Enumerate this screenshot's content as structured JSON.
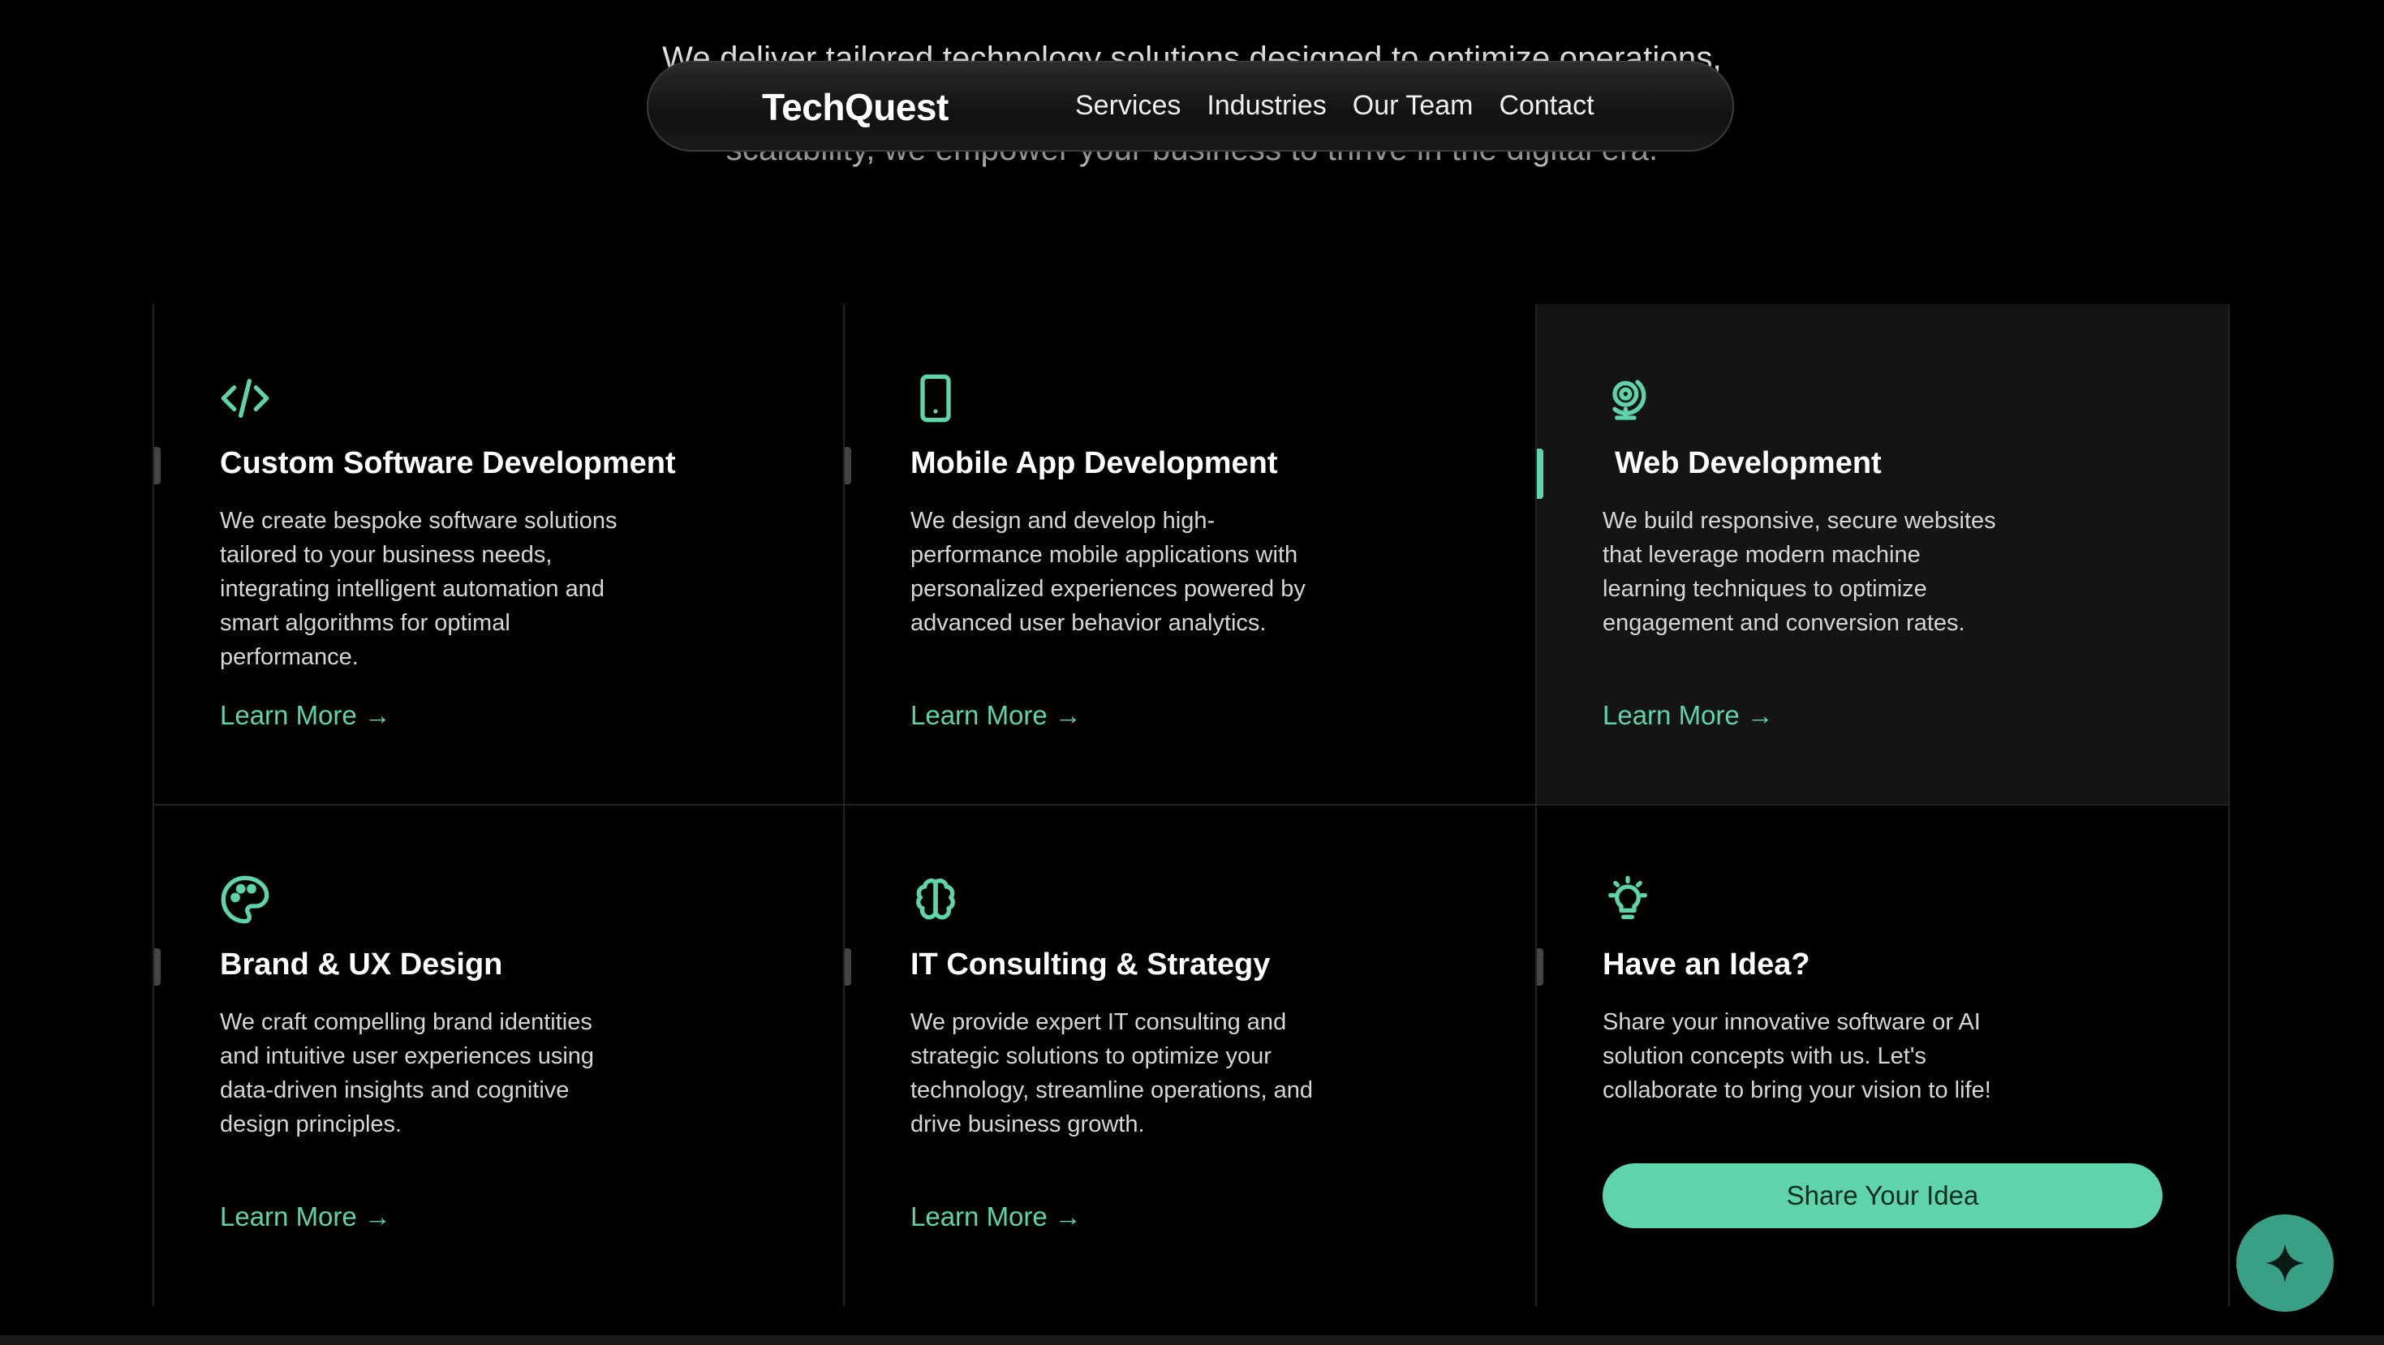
{
  "hero": {
    "line1": "We deliver tailored technology solutions designed to optimize operations,",
    "line2": "scalability, we empower your business to thrive in the digital era."
  },
  "navbar": {
    "logo": "TechQuest",
    "links": [
      "Services",
      "Industries",
      "Our Team",
      "Contact"
    ]
  },
  "colors": {
    "accent": "#5fd4aa",
    "background": "#000000",
    "highlight_card": "#141414",
    "fab": "#3aa085"
  },
  "services": [
    {
      "icon": "code-icon",
      "title": "Custom Software Development",
      "description": "We create bespoke software solutions tailored to your business needs, integrating intelligent automation and smart algorithms for optimal performance.",
      "link": "Learn More →"
    },
    {
      "icon": "smartphone-icon",
      "title": "Mobile App Development",
      "description": "We design and develop high-performance mobile applications with personalized experiences powered by advanced user behavior analytics.",
      "link": "Learn More →"
    },
    {
      "icon": "globe-icon",
      "title": "Web Development",
      "description": "We build responsive, secure websites that leverage modern machine learning techniques to optimize engagement and conversion rates.",
      "link": "Learn More →"
    },
    {
      "icon": "palette-icon",
      "title": "Brand & UX Design",
      "description": "We craft compelling brand identities and intuitive user experiences using data-driven insights and cognitive design principles.",
      "link": "Learn More →"
    },
    {
      "icon": "brain-icon",
      "title": "IT Consulting & Strategy",
      "description": "We provide expert IT consulting and strategic solutions to optimize your technology, streamline operations, and drive business growth.",
      "link": "Learn More →"
    }
  ],
  "cta": {
    "icon": "lightbulb-icon",
    "title": "Have an Idea?",
    "description": "Share your innovative software or AI solution concepts with us. Let's collaborate to bring your vision to life!",
    "button": "Share Your Idea"
  },
  "fab": {
    "icon": "sparkle-icon"
  }
}
